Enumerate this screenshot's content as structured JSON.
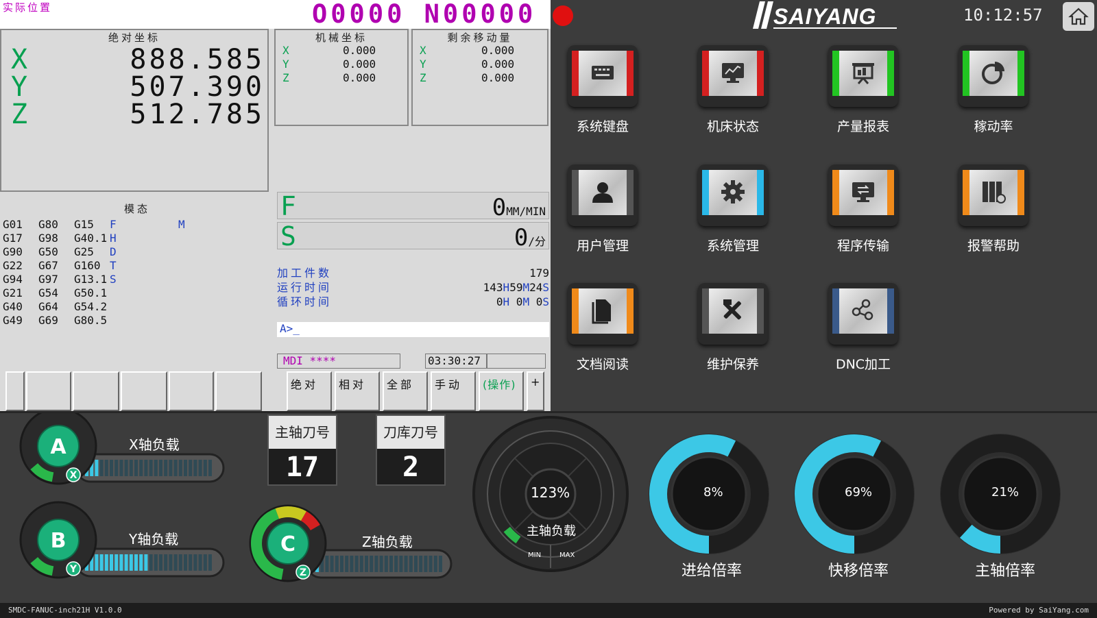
{
  "cnc": {
    "title": "实际位置",
    "program": "O0000 N00000",
    "abs": {
      "title": "绝对坐标",
      "axes": [
        {
          "l": "X",
          "v": "888.585"
        },
        {
          "l": "Y",
          "v": "507.390"
        },
        {
          "l": "Z",
          "v": "512.785"
        }
      ]
    },
    "mach": {
      "title": "机械坐标",
      "axes": [
        {
          "l": "X",
          "v": "0.000"
        },
        {
          "l": "Y",
          "v": "0.000"
        },
        {
          "l": "Z",
          "v": "0.000"
        }
      ]
    },
    "dist": {
      "title": "剩余移动量",
      "axes": [
        {
          "l": "X",
          "v": "0.000"
        },
        {
          "l": "Y",
          "v": "0.000"
        },
        {
          "l": "Z",
          "v": "0.000"
        }
      ]
    },
    "modal": {
      "title": "模态",
      "col1": [
        "G01",
        "G17",
        "G90",
        "G22",
        "G94",
        "G21",
        "G40",
        "G49"
      ],
      "col2": [
        "G80",
        "G98",
        "G50",
        "G67",
        "G97",
        "G54",
        "G64",
        "G69"
      ],
      "col3": [
        "G15",
        "G40.1",
        "G25",
        "G160",
        "G13.1",
        "G50.1",
        "G54.2",
        "G80.5"
      ],
      "col4": [
        "F",
        "H",
        "D",
        "T",
        "S"
      ],
      "extra": "M"
    },
    "feed": {
      "label": "F",
      "value": "0",
      "unit": "MM/MIN"
    },
    "spindle": {
      "label": "S",
      "value": "0",
      "unit": "/分"
    },
    "info": {
      "parts_label": "加工件数",
      "parts": "179",
      "run_label": "运行时间",
      "run_h": "143",
      "run_m": "59",
      "run_s": "24",
      "cycle_label": "循环时间",
      "cycle_h": "0",
      "cycle_m": "0",
      "cycle_s": "0",
      "unit_h": "H",
      "unit_m": "M",
      "unit_s": "S"
    },
    "prompt": "A>_",
    "mode": "MDI ****",
    "time": "03:30:27",
    "softkeys": [
      "绝对",
      "相对",
      "全部",
      "手动",
      "(操作)",
      "+"
    ]
  },
  "header": {
    "brand": "SAIYANG",
    "clock": "10:12:57",
    "home_icon": "home-icon"
  },
  "apps": [
    {
      "label": "系统键盘",
      "icon": "keyboard-icon",
      "color": "#d42020"
    },
    {
      "label": "机床状态",
      "icon": "monitor-chart-icon",
      "color": "#d42020"
    },
    {
      "label": "产量报表",
      "icon": "presentation-icon",
      "color": "#22c422"
    },
    {
      "label": "稼动率",
      "icon": "pie-chart-icon",
      "color": "#22c422"
    },
    {
      "label": "用户管理",
      "icon": "user-icon",
      "color": "#555555"
    },
    {
      "label": "系统管理",
      "icon": "gear-icon",
      "color": "#2ab8e8"
    },
    {
      "label": "程序传输",
      "icon": "transfer-icon",
      "color": "#f08a1a"
    },
    {
      "label": "报警帮助",
      "icon": "alarm-book-icon",
      "color": "#f08a1a"
    },
    {
      "label": "文档阅读",
      "icon": "document-icon",
      "color": "#f08a1a"
    },
    {
      "label": "维护保养",
      "icon": "tools-icon",
      "color": "#555555"
    },
    {
      "label": "DNC加工",
      "icon": "network-icon",
      "color": "#3a5a8a"
    }
  ],
  "loads": [
    {
      "badge": "A",
      "axis": "X",
      "label": "X轴负载",
      "level": 0.1
    },
    {
      "badge": "B",
      "axis": "Y",
      "label": "Y轴负载",
      "level": 0.5
    },
    {
      "badge": "C",
      "axis": "Z",
      "label": "Z轴负载",
      "level": 0.05
    }
  ],
  "tools": [
    {
      "title": "主轴刀号",
      "value": "17"
    },
    {
      "title": "刀库刀号",
      "value": "2"
    }
  ],
  "spindle_load": {
    "value": "123%",
    "label": "主轴负载",
    "min": "MIN",
    "max": "MAX",
    "level": 0.1
  },
  "gauges": [
    {
      "value": "8%",
      "label": "进给倍率",
      "level": 0.58
    },
    {
      "value": "69%",
      "label": "快移倍率",
      "level": 0.58
    },
    {
      "value": "21%",
      "label": "主轴倍率",
      "level": 0.12
    }
  ],
  "footer": {
    "left": "SMDC-FANUC-inch21H V1.0.0",
    "right": "Powered by SaiYang.com"
  },
  "colors": {
    "green": "#08a050",
    "magenta": "#b000b0",
    "blue": "#2040c0",
    "cyan": "#3cc8e6",
    "bg": "#3c3c3c"
  }
}
